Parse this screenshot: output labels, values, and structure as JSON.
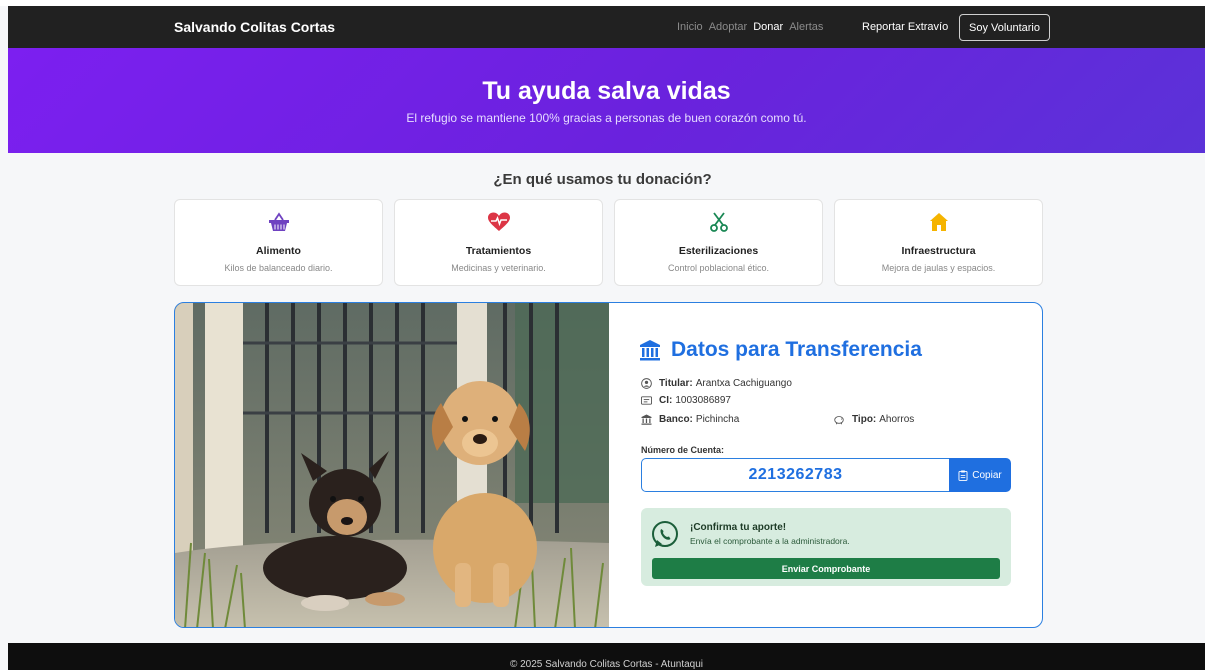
{
  "nav": {
    "brand": "Salvando Colitas Cortas",
    "links": [
      "Inicio",
      "Adoptar",
      "Donar",
      "Alertas"
    ],
    "active": "Donar",
    "report": "Reportar Extravío",
    "volunteer": "Soy Voluntario"
  },
  "hero": {
    "title": "Tu ayuda salva vidas",
    "subtitle": "El refugio se mantiene 100% gracias a personas de buen corazón como tú."
  },
  "uses": {
    "title": "¿En qué usamos tu donación?",
    "cards": [
      {
        "icon": "basket-icon",
        "title": "Alimento",
        "desc": "Kilos de balanceado diario.",
        "color": "#6f42c1"
      },
      {
        "icon": "heart-pulse-icon",
        "title": "Tratamientos",
        "desc": "Medicinas y veterinario.",
        "color": "#dc3545"
      },
      {
        "icon": "scissors-icon",
        "title": "Esterilizaciones",
        "desc": "Control poblacional ético.",
        "color": "#198754"
      },
      {
        "icon": "house-icon",
        "title": "Infraestructura",
        "desc": "Mejora de jaulas y espacios.",
        "color": "#f5b400"
      }
    ]
  },
  "transfer": {
    "title": "Datos para Transferencia",
    "holder_label": "Titular:",
    "holder": "Arantxa Cachiguango",
    "ci_label": "CI:",
    "ci": "1003086897",
    "bank_label": "Banco:",
    "bank": "Pichincha",
    "type_label": "Tipo:",
    "type": "Ahorros",
    "account_label": "Número de Cuenta:",
    "account": "2213262783",
    "copy": "Copiar",
    "confirm_title": "¡Confirma tu aporte!",
    "confirm_desc": "Envía el comprobante a la administradora.",
    "send": "Enviar Comprobante"
  },
  "footer": {
    "text": "© 2025 Salvando Colitas Cortas - Atuntaqui"
  },
  "colors": {
    "accent": "#1f6fe0",
    "hero": "#7c1ff0",
    "success": "#1e7d46"
  }
}
